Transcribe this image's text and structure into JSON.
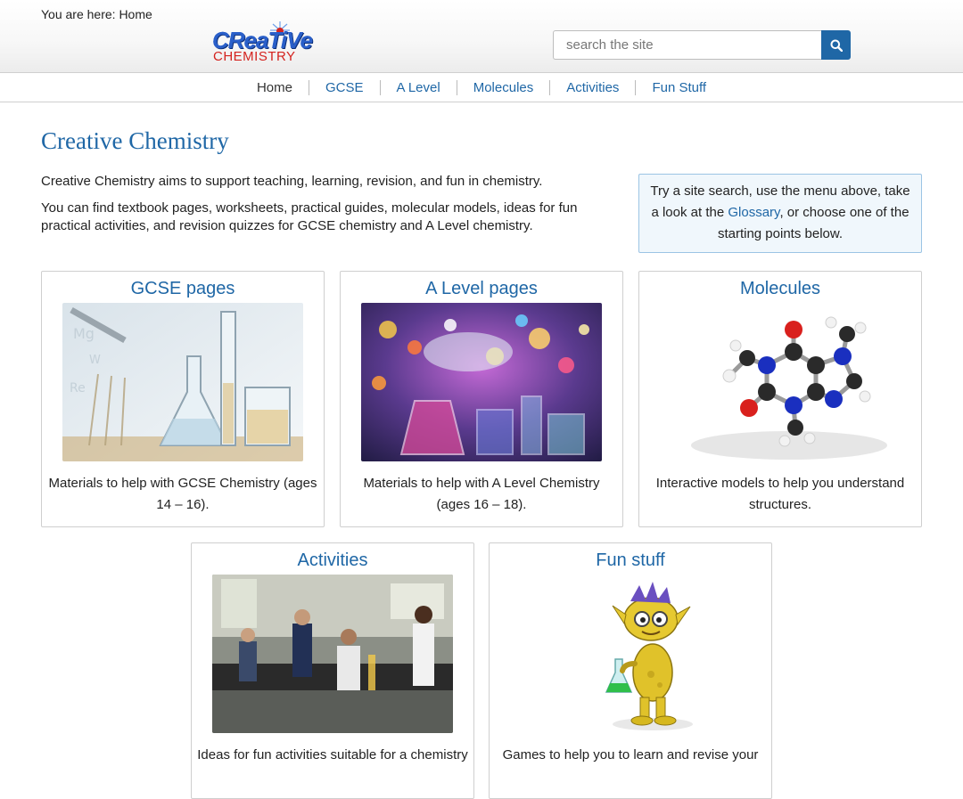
{
  "breadcrumb": {
    "text": "You are here: Home"
  },
  "logo": {
    "top_text": "CReaTiVe",
    "bottom_text": "CHEMISTRY"
  },
  "search": {
    "placeholder": "search the site",
    "icon": "search-icon"
  },
  "nav": {
    "items": [
      {
        "label": "Home"
      },
      {
        "label": "GCSE"
      },
      {
        "label": "A Level"
      },
      {
        "label": "Molecules"
      },
      {
        "label": "Activities"
      },
      {
        "label": "Fun Stuff"
      }
    ]
  },
  "main": {
    "title": "Creative Chemistry",
    "intro_1": "Creative Chemistry aims to support teaching, learning, revision, and fun in chemistry.",
    "intro_2": "You can find textbook pages, worksheets, practical guides, molecular models, ideas for fun practical activities, and revision quizzes for GCSE chemistry and A Level chemistry."
  },
  "tip": {
    "before": "Try a site search, use the menu above, take a look at the ",
    "link": "Glossary",
    "after": ", or choose one of the starting points below."
  },
  "cards": [
    {
      "title": "GCSE pages",
      "desc": "Materials to help with GCSE Chemistry (ages 14 – 16)."
    },
    {
      "title": "A Level pages",
      "desc": "Materials to help with A Level Chemistry (ages 16 – 18)."
    },
    {
      "title": "Molecules",
      "desc": "Interactive models to help you understand structures."
    },
    {
      "title": "Activities",
      "desc": "Ideas for fun activities suitable for a chemistry"
    },
    {
      "title": "Fun stuff",
      "desc": "Games to help you to learn and revise your"
    }
  ],
  "colors": {
    "link": "#1f67a6",
    "search_button": "#1f67a6",
    "logo_blue": "#2a5fc9",
    "logo_red": "#d4231f"
  }
}
